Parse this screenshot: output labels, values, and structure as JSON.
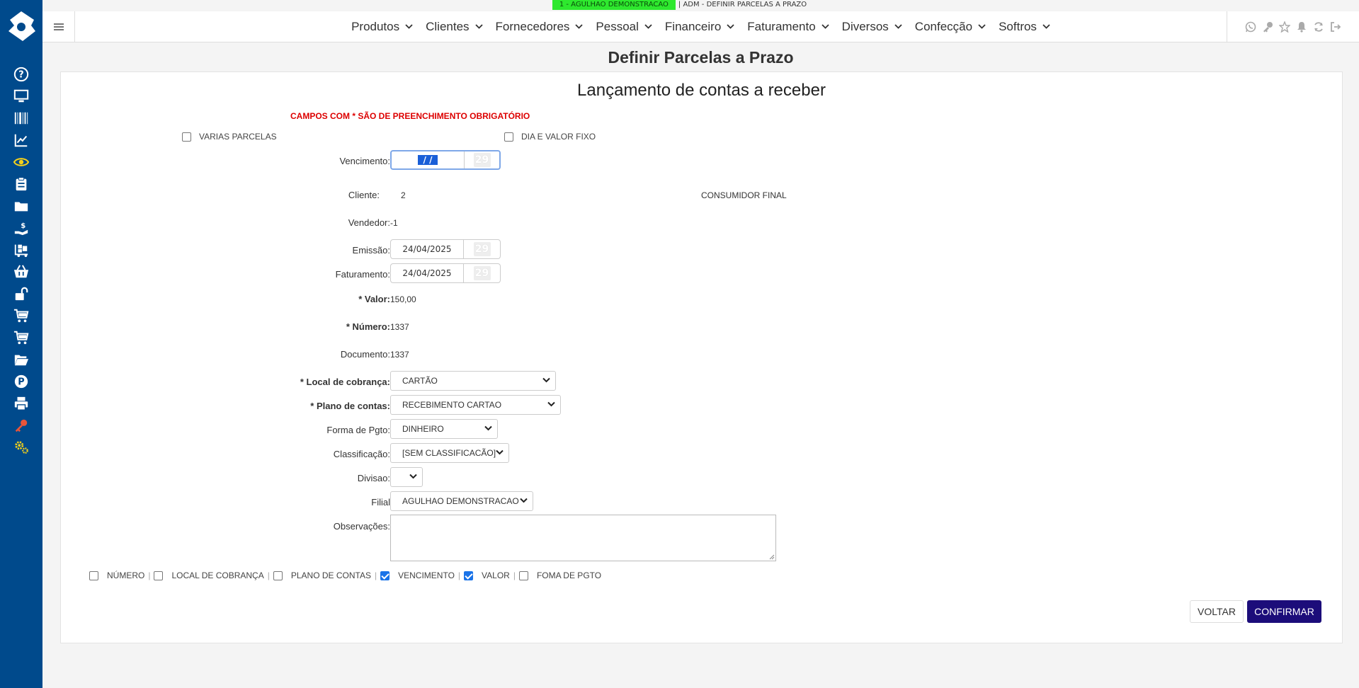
{
  "status": {
    "badge": "1 - AGULHAO DEMONSTRACAO",
    "user": "| ADM - DEFINIR PARCELAS A PRAZO"
  },
  "nav": {
    "items": [
      "Produtos",
      "Clientes",
      "Fornecedores",
      "Pessoal",
      "Financeiro",
      "Faturamento",
      "Diversos",
      "Confecção",
      "Softros"
    ],
    "right_icons": [
      "whatsapp-icon",
      "key-icon",
      "star-icon",
      "bell-icon",
      "refresh-icon",
      "logout-icon"
    ]
  },
  "sidebar": {
    "icons": [
      "help-icon",
      "monitor-icon",
      "barcode-icon",
      "chart-icon",
      "eye-icon",
      "clipboard-icon",
      "folder-icon",
      "money-hand-icon",
      "truck-icon",
      "basket-icon",
      "unlock-icon",
      "cart-icon",
      "cart-icon",
      "folder-icon",
      "parking-icon",
      "printer-icon",
      "key-icon",
      "gears-icon"
    ]
  },
  "page": {
    "title": "Definir Parcelas a Prazo"
  },
  "form": {
    "title": "Lançamento de contas a receber",
    "required_note": "CAMPOS COM * SÃO DE PREENCHIMENTO OBRIGATÓRIO",
    "varias_parcelas_label": "VARIAS PARCELAS",
    "dia_valor_fixo_label": "DIA E VALOR FIXO",
    "vencimento_label": "Vencimento:",
    "vencimento_value": " /  / ",
    "cliente_label": "Cliente:",
    "cliente_code": "2",
    "cliente_name": "CONSUMIDOR FINAL",
    "vendedor_label": "Vendedor:",
    "vendedor_value": "-1",
    "emissao_label": "Emissão:",
    "emissao_value": "24/04/2025",
    "faturamento_label": "Faturamento:",
    "faturamento_value": "24/04/2025",
    "calendar_glyph": "29",
    "valor_label": "* Valor:",
    "valor_value": "150,00",
    "numero_label": "* Número:",
    "numero_value": "1337",
    "documento_label": "Documento:",
    "documento_value": "1337",
    "local_cobranca_label": "* Local de cobrança:",
    "local_cobranca_value": "CARTÃO",
    "plano_contas_label": "* Plano de contas:",
    "plano_contas_value": "RECEBIMENTO CARTAO",
    "forma_pgto_label": "Forma de Pgto:",
    "forma_pgto_value": "DINHEIRO",
    "classificacao_label": "Classificação:",
    "classificacao_value": "[SEM CLASSIFICACÃO]",
    "divisao_label": "Divisao:",
    "divisao_value": "",
    "filial_label": "Filial",
    "filial_value": "AGULHAO DEMONSTRACAO",
    "observacoes_label": "Observações:"
  },
  "bottom_options": [
    {
      "label": "NÚMERO",
      "checked": false
    },
    {
      "label": "LOCAL DE COBRANÇA",
      "checked": false
    },
    {
      "label": "PLANO DE CONTAS",
      "checked": false
    },
    {
      "label": "VENCIMENTO",
      "checked": true
    },
    {
      "label": "VALOR",
      "checked": true
    },
    {
      "label": "FOMA DE PGTO",
      "checked": false
    }
  ],
  "buttons": {
    "back": "VOLTAR",
    "confirm": "CONFIRMAR"
  },
  "colors": {
    "sidebar": "#004a8c",
    "confirm": "#1c0d7a",
    "required": "#dd0000",
    "status_badge": "#2ee82e"
  }
}
